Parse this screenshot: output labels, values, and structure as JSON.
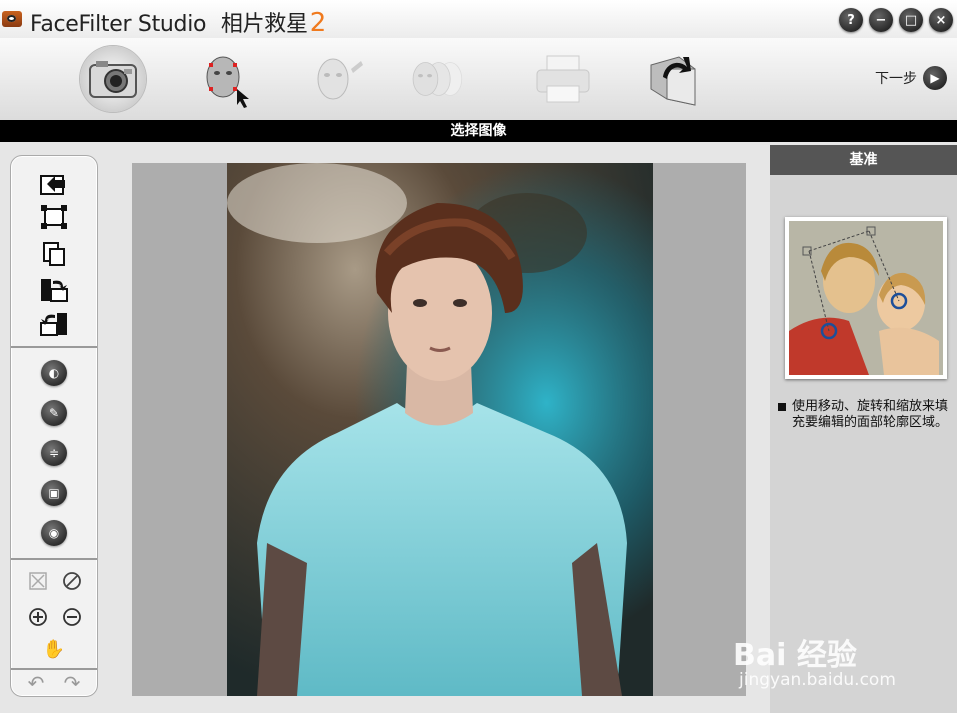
{
  "titlebar": {
    "app_name": "FaceFilter Studio",
    "app_subtitle": "相片救星",
    "version": "2",
    "buttons": [
      "?",
      "−",
      "□",
      "×"
    ]
  },
  "toolbar": {
    "tools": [
      "camera-icon",
      "face-select-icon",
      "face-edit-icon",
      "face-morph-icon",
      "printer-icon",
      "export-icon"
    ],
    "next_label": "下一步"
  },
  "header": {
    "title": "选择图像"
  },
  "palette": {
    "group1": [
      "open-icon",
      "crop-icon",
      "paste-icon",
      "rotate-right-icon",
      "rotate-left-icon"
    ],
    "group2": [
      "adjust-icon",
      "tool-icon",
      "level-icon",
      "frame-icon",
      "eye-icon"
    ],
    "group3": [
      "fit-icon",
      "cancel-icon",
      "zoom-in-icon",
      "zoom-out-icon",
      "hand-icon"
    ],
    "group4": [
      "undo-icon",
      "redo-icon"
    ]
  },
  "right_panel": {
    "title": "基准",
    "instruction": "使用移动、旋转和缩放来填充要编辑的面部轮廓区域。"
  },
  "watermark": {
    "brand": "Bai 经验",
    "url": "jingyan.baidu.com"
  }
}
